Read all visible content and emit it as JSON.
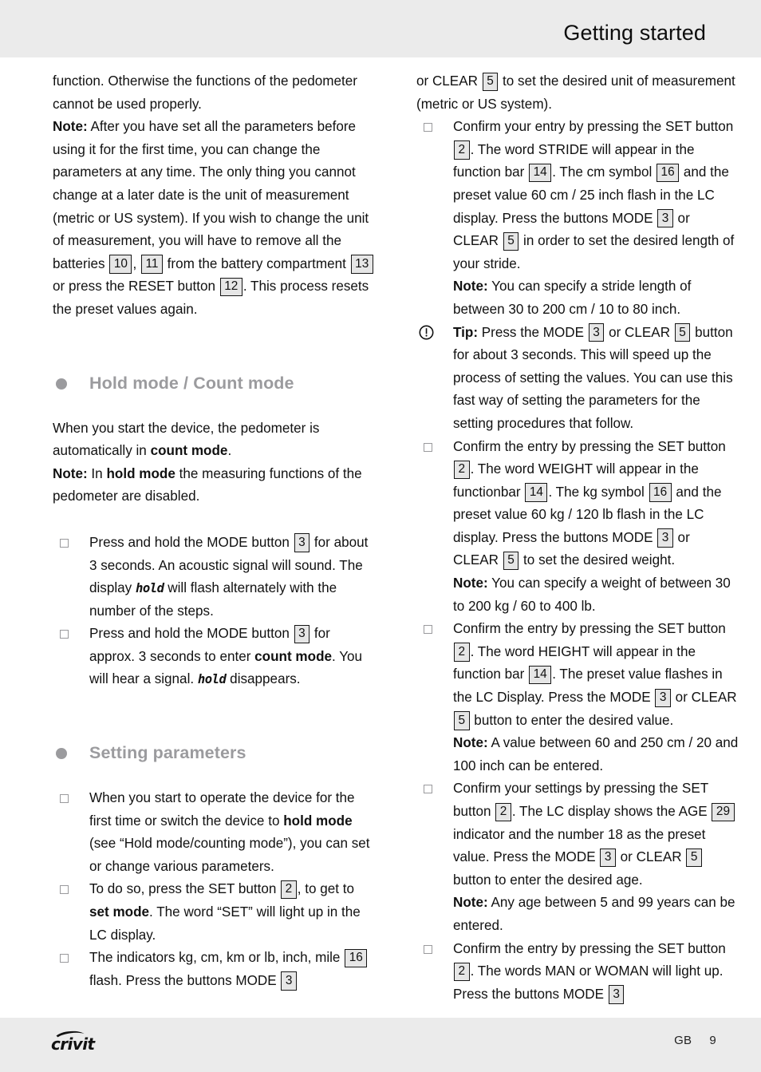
{
  "header": {
    "title": "Getting started"
  },
  "footer": {
    "brand": "crivit",
    "language_code": "GB",
    "page_number": "9"
  },
  "colors": {
    "band_background": "#ebebeb",
    "heading_grey": "#9b9b9e",
    "refbox_fill": "#e6e6e6",
    "refbox_border": "#161616",
    "body_text": "#111111"
  },
  "left_column": {
    "intro_paragraph": {
      "line1": "function. Otherwise the functions of the pedometer cannot be used properly.",
      "note_label": "Note:",
      "note_part1": " After you have set all the parameters before using it for the first time, you can change the parameters at any time. The only thing you cannot change at a later date is the unit of measurement (metric or US system). If you wish to change the unit of measurement, you will have to remove all the batteries ",
      "ref_10": "10",
      "comma": ", ",
      "ref_11": "11",
      "note_part2": " from the battery compartment ",
      "ref_13": "13",
      "note_part3": " or press the RESET button ",
      "ref_12": "12",
      "note_part4": ". This process resets the preset values again."
    },
    "heading_hold_count": "Hold mode / Count mode",
    "hold_count_body": {
      "part1": "When you start the device, the pedometer is automatically in ",
      "bold1": "count mode",
      "part2": ".",
      "note_label": "Note:",
      "part3": " In ",
      "bold2": "hold mode",
      "part4": " the measuring functions of the pedometer are disabled."
    },
    "hold_count_items": [
      {
        "part1": "Press and hold the MODE button ",
        "ref": "3",
        "part2": " for about 3 seconds. An acoustic signal will sound. The display ",
        "lcd": "hold",
        "part3": " will flash alternately with the number of the steps."
      },
      {
        "part1": "Press and hold the MODE button ",
        "ref": "3",
        "part2": " for approx. 3 seconds to enter ",
        "bold1": "count mode",
        "part3": ". You will hear a signal. ",
        "lcd": "hold",
        "part4": " disappears."
      }
    ],
    "heading_setting_parameters": "Setting parameters",
    "setting_items": [
      {
        "part1": "When you start to operate the device for the first time or switch the device to ",
        "bold1": "hold mode",
        "part2": " (see “Hold mode/counting mode”), you can set or change various parameters."
      },
      {
        "part1": "To do so, press the SET button ",
        "ref": "2",
        "part2": ", to get to ",
        "bold1": "set mode",
        "part3": ". The word “SET” will light up in the LC display."
      },
      {
        "part1": "The indicators kg, cm, km or lb, inch, mile ",
        "ref_16": "16",
        "part2": " flash. Press the buttons MODE ",
        "ref_3": "3"
      }
    ]
  },
  "right_column": {
    "continued_item": {
      "part1": "or CLEAR ",
      "ref_5": "5",
      "part2": " to set the desired unit of measurement (metric or US system)."
    },
    "items": [
      {
        "bullet": "square",
        "part1": "Confirm your entry by pressing the SET button ",
        "ref_2": "2",
        "part2": ". The word STRIDE will appear in the function bar ",
        "ref_14": "14",
        "part3": ". The cm symbol ",
        "ref_16": "16",
        "part4": " and the preset value 60 cm / 25 inch flash in the LC display. Press the buttons MODE ",
        "ref_3": "3",
        "part5": " or CLEAR ",
        "ref_5": "5",
        "part6": " in order to set the desired length of your stride.",
        "note_label": "Note:",
        "note_text": " You can specify a stride length of between 30 to 200 cm / 10 to 80 inch."
      },
      {
        "bullet": "warning",
        "tip_label": "Tip:",
        "part1": " Press the MODE ",
        "ref_3": "3",
        "part2": " or CLEAR ",
        "ref_5": "5",
        "part3": " button for about 3 seconds. This will speed up the process of setting the values. You can use this fast way of setting the parameters for the setting procedures that follow."
      },
      {
        "bullet": "square",
        "part1": "Confirm the entry by pressing the SET button ",
        "ref_2": "2",
        "part2": ". The word WEIGHT will appear in the functionbar ",
        "ref_14": "14",
        "part3": ". The kg symbol ",
        "ref_16": "16",
        "part4": " and the preset value 60 kg / 120 lb flash in the LC display. Press the buttons MODE ",
        "ref_3": "3",
        "part5": " or CLEAR ",
        "ref_5": "5",
        "part6": " to set the desired weight.",
        "note_label": "Note:",
        "note_text": " You can specify a weight of between 30 to 200 kg / 60 to 400 lb."
      },
      {
        "bullet": "square",
        "part1": "Confirm the entry by pressing the SET button ",
        "ref_2": "2",
        "part2": ". The word HEIGHT will appear in the function bar ",
        "ref_14": "14",
        "part3": ". The preset value flashes in the LC Display. Press the MODE ",
        "ref_3": "3",
        "part4": " or CLEAR ",
        "ref_5": "5",
        "part5": " button to enter the desired value.",
        "note_label": "Note:",
        "note_text": " A value between 60 and 250 cm / 20 and 100 inch can be entered."
      },
      {
        "bullet": "square",
        "part1": "Confirm your settings by pressing the SET button ",
        "ref_2": "2",
        "part2": ". The LC display shows the AGE ",
        "ref_29": "29",
        "part3": " indicator and the number 18 as the preset value. Press the MODE ",
        "ref_3": "3",
        "part4": " or CLEAR ",
        "ref_5": "5",
        "part5": " button to enter the desired age.",
        "note_label": "Note:",
        "note_text": " Any age between 5 and 99 years can be entered."
      },
      {
        "bullet": "square",
        "part1": "Confirm the entry by pressing the SET button ",
        "ref_2": "2",
        "part2": ". The words MAN or WOMAN will light up. Press the buttons MODE ",
        "ref_3": "3"
      }
    ]
  }
}
